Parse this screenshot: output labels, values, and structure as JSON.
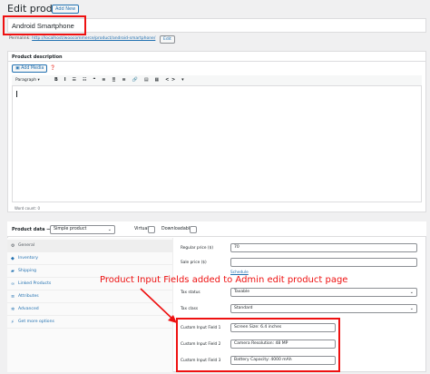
{
  "header": {
    "title": "Edit product",
    "add_new": "Add New"
  },
  "product_title": {
    "value": "Android Smartphone"
  },
  "permalink": {
    "label": "Permalink:",
    "url": "http://localhost/woocommerce/product/android-smartphone/",
    "edit": "Edit"
  },
  "description": {
    "heading": "Product description",
    "add_media": "Add Media",
    "format_select": "Paragraph",
    "toolbar_icons": "B I ☰ ☷ ❝ ≡ ≣ ≡ 🔗 ▤ ▦ <> ▾",
    "word_count": "Word count: 0"
  },
  "product_data": {
    "label": "Product data —",
    "type": "Simple product",
    "virtual": "Virtual:",
    "downloadable": "Downloadable:",
    "tabs": [
      {
        "label": "General",
        "icon": "wrench-icon"
      },
      {
        "label": "Inventory",
        "icon": "box-icon"
      },
      {
        "label": "Shipping",
        "icon": "truck-icon"
      },
      {
        "label": "Linked Products",
        "icon": "link-icon"
      },
      {
        "label": "Attributes",
        "icon": "list-icon"
      },
      {
        "label": "Advanced",
        "icon": "gear-icon"
      },
      {
        "label": "Get more options",
        "icon": "plug-icon"
      }
    ],
    "fields": {
      "regular_price": {
        "label": "Regular price ($)",
        "value": "70"
      },
      "sale_price": {
        "label": "Sale price ($)",
        "value": ""
      },
      "schedule": "Schedule",
      "tax_status": {
        "label": "Tax status",
        "value": "Taxable"
      },
      "tax_class": {
        "label": "Tax class",
        "value": "Standard"
      },
      "custom_1": {
        "label": "Custom Input Field 1",
        "value": "Screen Size: 6.4 inches"
      },
      "custom_2": {
        "label": "Custom Input Field 2",
        "value": "Camera Resolution: 48 MP"
      },
      "custom_3": {
        "label": "Custom Input Field 3",
        "value": "Battery Capacity: 4000 mAh"
      }
    }
  },
  "annotation": {
    "text": "Product Input Fields added to Admin edit product page",
    "color": "#ee1111"
  }
}
